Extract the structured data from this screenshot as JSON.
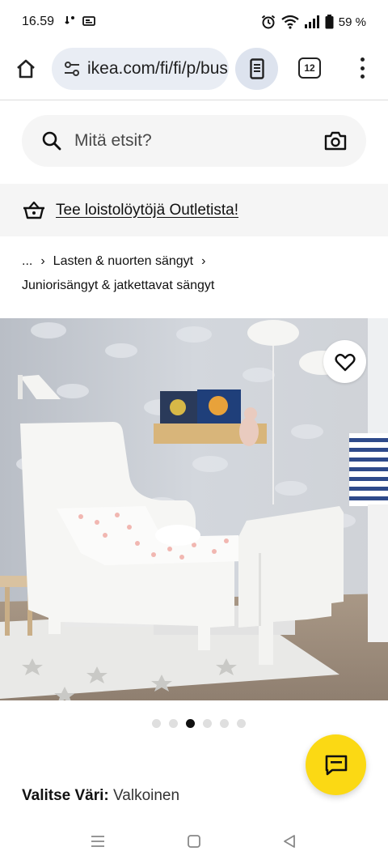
{
  "status_bar": {
    "time": "16.59",
    "battery": "59 %"
  },
  "browser": {
    "url": "ikea.com/fi/fi/p/busu",
    "tab_count": "12"
  },
  "search": {
    "placeholder": "Mitä etsit?"
  },
  "banner": {
    "text": "Tee loistolöytöjä Outletista!"
  },
  "breadcrumb": {
    "ellipsis": "...",
    "items": [
      "Lasten & nuorten sängyt",
      "Juniorisängyt & jatkettavat sängyt"
    ]
  },
  "gallery": {
    "slide_count": 6,
    "active_index": 2
  },
  "product": {
    "color_label": "Valitse Väri:",
    "color_value": "Valkoinen"
  },
  "colors": {
    "chat_button": "#fbd914",
    "url_bar": "#e9edf4",
    "banner_bg": "#f5f5f5"
  }
}
